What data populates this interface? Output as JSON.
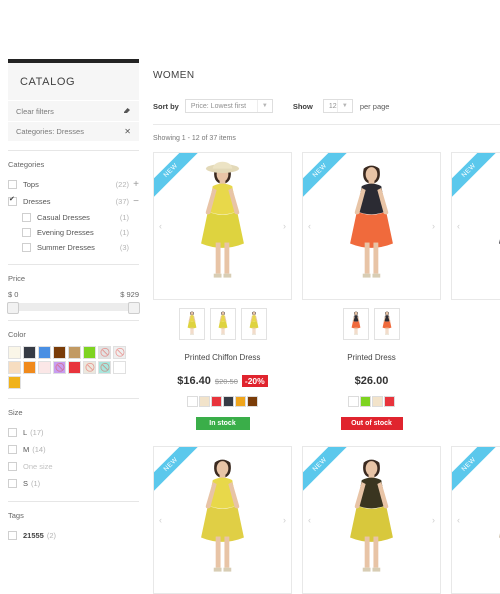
{
  "sidebar": {
    "title": "CATALOG",
    "clear_filters": {
      "label": "Clear filters",
      "icon": "eraser-icon"
    },
    "active_filter": {
      "label": "Categories: Dresses",
      "remove": "✕"
    },
    "categories": {
      "title": "Categories",
      "items": [
        {
          "label": "Tops",
          "count": "(22)",
          "checked": false,
          "toggle": "+",
          "sub": false,
          "dim": false
        },
        {
          "label": "Dresses",
          "count": "(37)",
          "checked": true,
          "toggle": "−",
          "sub": false,
          "dim": false
        },
        {
          "label": "Casual Dresses",
          "count": "(1)",
          "checked": false,
          "toggle": "",
          "sub": true,
          "dim": false
        },
        {
          "label": "Evening Dresses",
          "count": "(1)",
          "checked": false,
          "toggle": "",
          "sub": true,
          "dim": false
        },
        {
          "label": "Summer Dresses",
          "count": "(3)",
          "checked": false,
          "toggle": "",
          "sub": true,
          "dim": false
        }
      ]
    },
    "price": {
      "title": "Price",
      "min": "$ 0",
      "max": "$ 929"
    },
    "color": {
      "title": "Color",
      "swatches": [
        {
          "hex": "#faf6e8",
          "available": true
        },
        {
          "hex": "#363b45",
          "available": true
        },
        {
          "hex": "#4a8fe3",
          "available": true
        },
        {
          "hex": "#7a3c08",
          "available": true
        },
        {
          "hex": "#c29a63",
          "available": true
        },
        {
          "hex": "#7ed321",
          "available": true
        },
        {
          "hex": "#e2e2e2",
          "available": false
        },
        {
          "hex": "#efefef",
          "available": false
        },
        {
          "hex": "#f7ddc0",
          "available": true
        },
        {
          "hex": "#f08a1c",
          "available": true
        },
        {
          "hex": "#fbe7e7",
          "available": true
        },
        {
          "hex": "#c79df0",
          "available": false
        },
        {
          "hex": "#e8343c",
          "available": true
        },
        {
          "hex": "#ece7dd",
          "available": false
        },
        {
          "hex": "#a9e6dd",
          "available": false
        },
        {
          "hex": "#ffffff",
          "available": true
        },
        {
          "hex": "#f0b21a",
          "available": true
        }
      ]
    },
    "size": {
      "title": "Size",
      "items": [
        {
          "label": "L",
          "count": "(17)",
          "dim": false
        },
        {
          "label": "M",
          "count": "(14)",
          "dim": false
        },
        {
          "label": "One size",
          "count": "",
          "dim": true
        },
        {
          "label": "S",
          "count": "(1)",
          "dim": false
        }
      ]
    },
    "tags": {
      "title": "Tags",
      "items": [
        {
          "label": "21555",
          "count": "(2)"
        }
      ]
    }
  },
  "main": {
    "page_title": "WOMEN",
    "sort_label": "Sort by",
    "sort_value": "Price: Lowest first",
    "show_label": "Show",
    "show_value": "12",
    "per_page": "per page",
    "showing": "Showing 1 - 12 of 37 items",
    "products": [
      {
        "name": "Printed Chiffon Dress",
        "price": "$16.40",
        "old_price": "$20.50",
        "discount": "-20%",
        "badge": "In stock",
        "badge_type": "in",
        "ribbon": "NEW",
        "colors": [
          "#ffffff",
          "#f2e3ca",
          "#e8343c",
          "#363b45",
          "#f0a51c",
          "#7a3c08"
        ],
        "thumbs": 3
      },
      {
        "name": "Printed Dress",
        "price": "$26.00",
        "old_price": "",
        "discount": "",
        "badge": "Out of stock",
        "badge_type": "out",
        "ribbon": "NEW",
        "colors": [
          "#ffffff",
          "#7ed321",
          "#f2e3ca",
          "#e8343c"
        ],
        "thumbs": 2
      },
      {
        "name": "",
        "price": "",
        "old_price": "",
        "discount": "",
        "badge": "",
        "badge_type": "",
        "ribbon": "NEW",
        "colors": [],
        "thumbs": 1
      }
    ],
    "products_row2": [
      {
        "ribbon": "NEW"
      },
      {
        "ribbon": "NEW"
      },
      {
        "ribbon": "NEW"
      }
    ]
  }
}
